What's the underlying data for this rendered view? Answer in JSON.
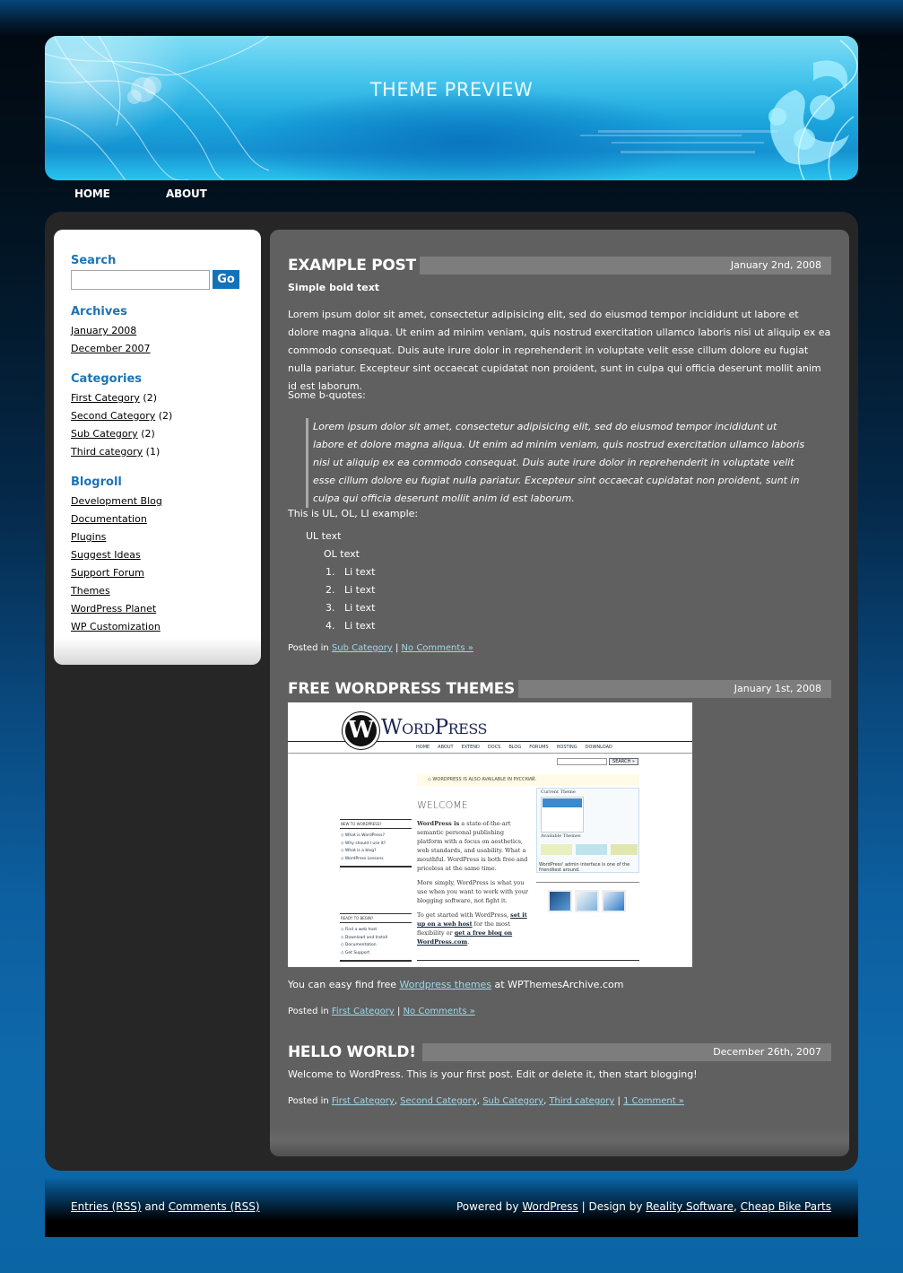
{
  "header": {
    "title": "THEME PREVIEW"
  },
  "nav": {
    "items": [
      {
        "label": "HOME"
      },
      {
        "label": "ABOUT"
      }
    ]
  },
  "sidebar": {
    "search": {
      "heading": "Search",
      "placeholder": "",
      "value": "",
      "button": "Go"
    },
    "archives": {
      "heading": "Archives",
      "items": [
        {
          "label": "January 2008"
        },
        {
          "label": "December 2007"
        }
      ]
    },
    "categories": {
      "heading": "Categories",
      "items": [
        {
          "label": "First Category",
          "count": "(2)"
        },
        {
          "label": "Second Category",
          "count": "(2)"
        },
        {
          "label": "Sub Category",
          "count": "(2)"
        },
        {
          "label": "Third category",
          "count": "(1)"
        }
      ]
    },
    "blogroll": {
      "heading": "Blogroll",
      "items": [
        {
          "label": "Development Blog"
        },
        {
          "label": "Documentation"
        },
        {
          "label": "Plugins"
        },
        {
          "label": "Suggest Ideas"
        },
        {
          "label": "Support Forum"
        },
        {
          "label": "Themes"
        },
        {
          "label": "WordPress Planet"
        },
        {
          "label": "WP Customization"
        }
      ]
    }
  },
  "posts": [
    {
      "title": "EXAMPLE POST",
      "date": "January 2nd, 2008",
      "bold_text": "Simple bold text",
      "paragraph": "Lorem ipsum dolor sit amet, consectetur adipisicing elit, sed do eiusmod tempor incididunt ut labore et dolore magna aliqua. Ut enim ad minim veniam, quis nostrud exercitation ullamco laboris nisi ut aliquip ex ea commodo consequat. Duis aute irure dolor in reprehenderit in voluptate velit esse cillum dolore eu fugiat nulla pariatur. Excepteur sint occaecat cupidatat non proident, sunt in culpa qui officia deserunt mollit anim id est laborum.",
      "bquote_intro": "Some b-quotes:",
      "blockquote": "Lorem ipsum dolor sit amet, consectetur adipisicing elit, sed do eiusmod tempor incididunt ut labore et dolore magna aliqua. Ut enim ad minim veniam, quis nostrud exercitation ullamco laboris nisi ut aliquip ex ea commodo consequat. Duis aute irure dolor in reprehenderit in voluptate velit esse cillum dolore eu fugiat nulla pariatur. Excepteur sint occaecat cupidatat non proident, sunt in culpa qui officia deserunt mollit anim id est laborum.",
      "list_intro": "This is UL, OL, LI example:",
      "ul_text": "UL text",
      "ol_text": "OL text",
      "li_items": [
        {
          "num": "1.",
          "text": "Li text"
        },
        {
          "num": "2.",
          "text": "Li text"
        },
        {
          "num": "3.",
          "text": "Li text"
        },
        {
          "num": "4.",
          "text": "Li text"
        }
      ],
      "meta": {
        "posted_in": "Posted in",
        "categories": [
          "Sub Category"
        ],
        "separator": "|",
        "comments": "No Comments »"
      }
    },
    {
      "title": "FREE WORDPRESS THEMES",
      "date": "January 1st, 2008",
      "image": {
        "logo": "WordPress",
        "nav": [
          "HOME",
          "ABOUT",
          "EXTEND",
          "DOCS",
          "BLOG",
          "FORUMS",
          "HOSTING",
          "DOWNLOAD"
        ],
        "search_button": "SEARCH »",
        "notice": "◇ WORDPRESS IS ALSO AVAILABLE IN РУССКИЙ.",
        "welcome": "WELCOME",
        "new_heading": "NEW TO WORDPRESS?",
        "new_links": [
          "What is WordPress?",
          "Why should I use it?",
          "What is a blog?",
          "WordPress Lessons"
        ],
        "ready_heading": "READY TO BEGIN?",
        "ready_links": [
          "Find a web host",
          "Download and Install",
          "Documentation",
          "Get Support"
        ],
        "body1_bold": "WordPress is",
        "body1": " a state-of-the-art semantic personal publishing platform with a focus on aesthetics, web standards, and usability. What a mouthful. WordPress is both free and priceless at the same time.",
        "body2": "More simply, WordPress is what you use when you want to work with your blogging software, not fight it.",
        "body3_a": "To get started with WordPress, ",
        "body3_link1": "set it up on a web host",
        "body3_b": " for the most flexibility or ",
        "body3_link2": "get a free blog on WordPress.com",
        "current_theme": "Current Theme",
        "available_themes": "Available Themes",
        "caption": "WordPress' admin interface is one of the friendliest around."
      },
      "text_before": "You can easy find free ",
      "text_link": "Wordpress themes",
      "text_after": " at WPThemesArchive.com",
      "meta": {
        "posted_in": "Posted in",
        "categories": [
          "First Category"
        ],
        "separator": "|",
        "comments": "No Comments »"
      }
    },
    {
      "title": "HELLO WORLD!",
      "date": "December 26th, 2007",
      "paragraph": "Welcome to WordPress. This is your first post. Edit or delete it, then start blogging!",
      "meta": {
        "posted_in": "Posted in",
        "categories": [
          "First Category",
          "Second Category",
          "Sub Category",
          "Third category"
        ],
        "separator": "|",
        "comments": "1 Comment »"
      }
    }
  ],
  "footer": {
    "entries_rss": "Entries (RSS)",
    "and": " and ",
    "comments_rss": "Comments (RSS)",
    "powered_by": "Powered by ",
    "wordpress": "WordPress",
    "design_by": " | Design by ",
    "reality": "Reality Software",
    "comma": ", ",
    "bike": "Cheap Bike Parts"
  }
}
